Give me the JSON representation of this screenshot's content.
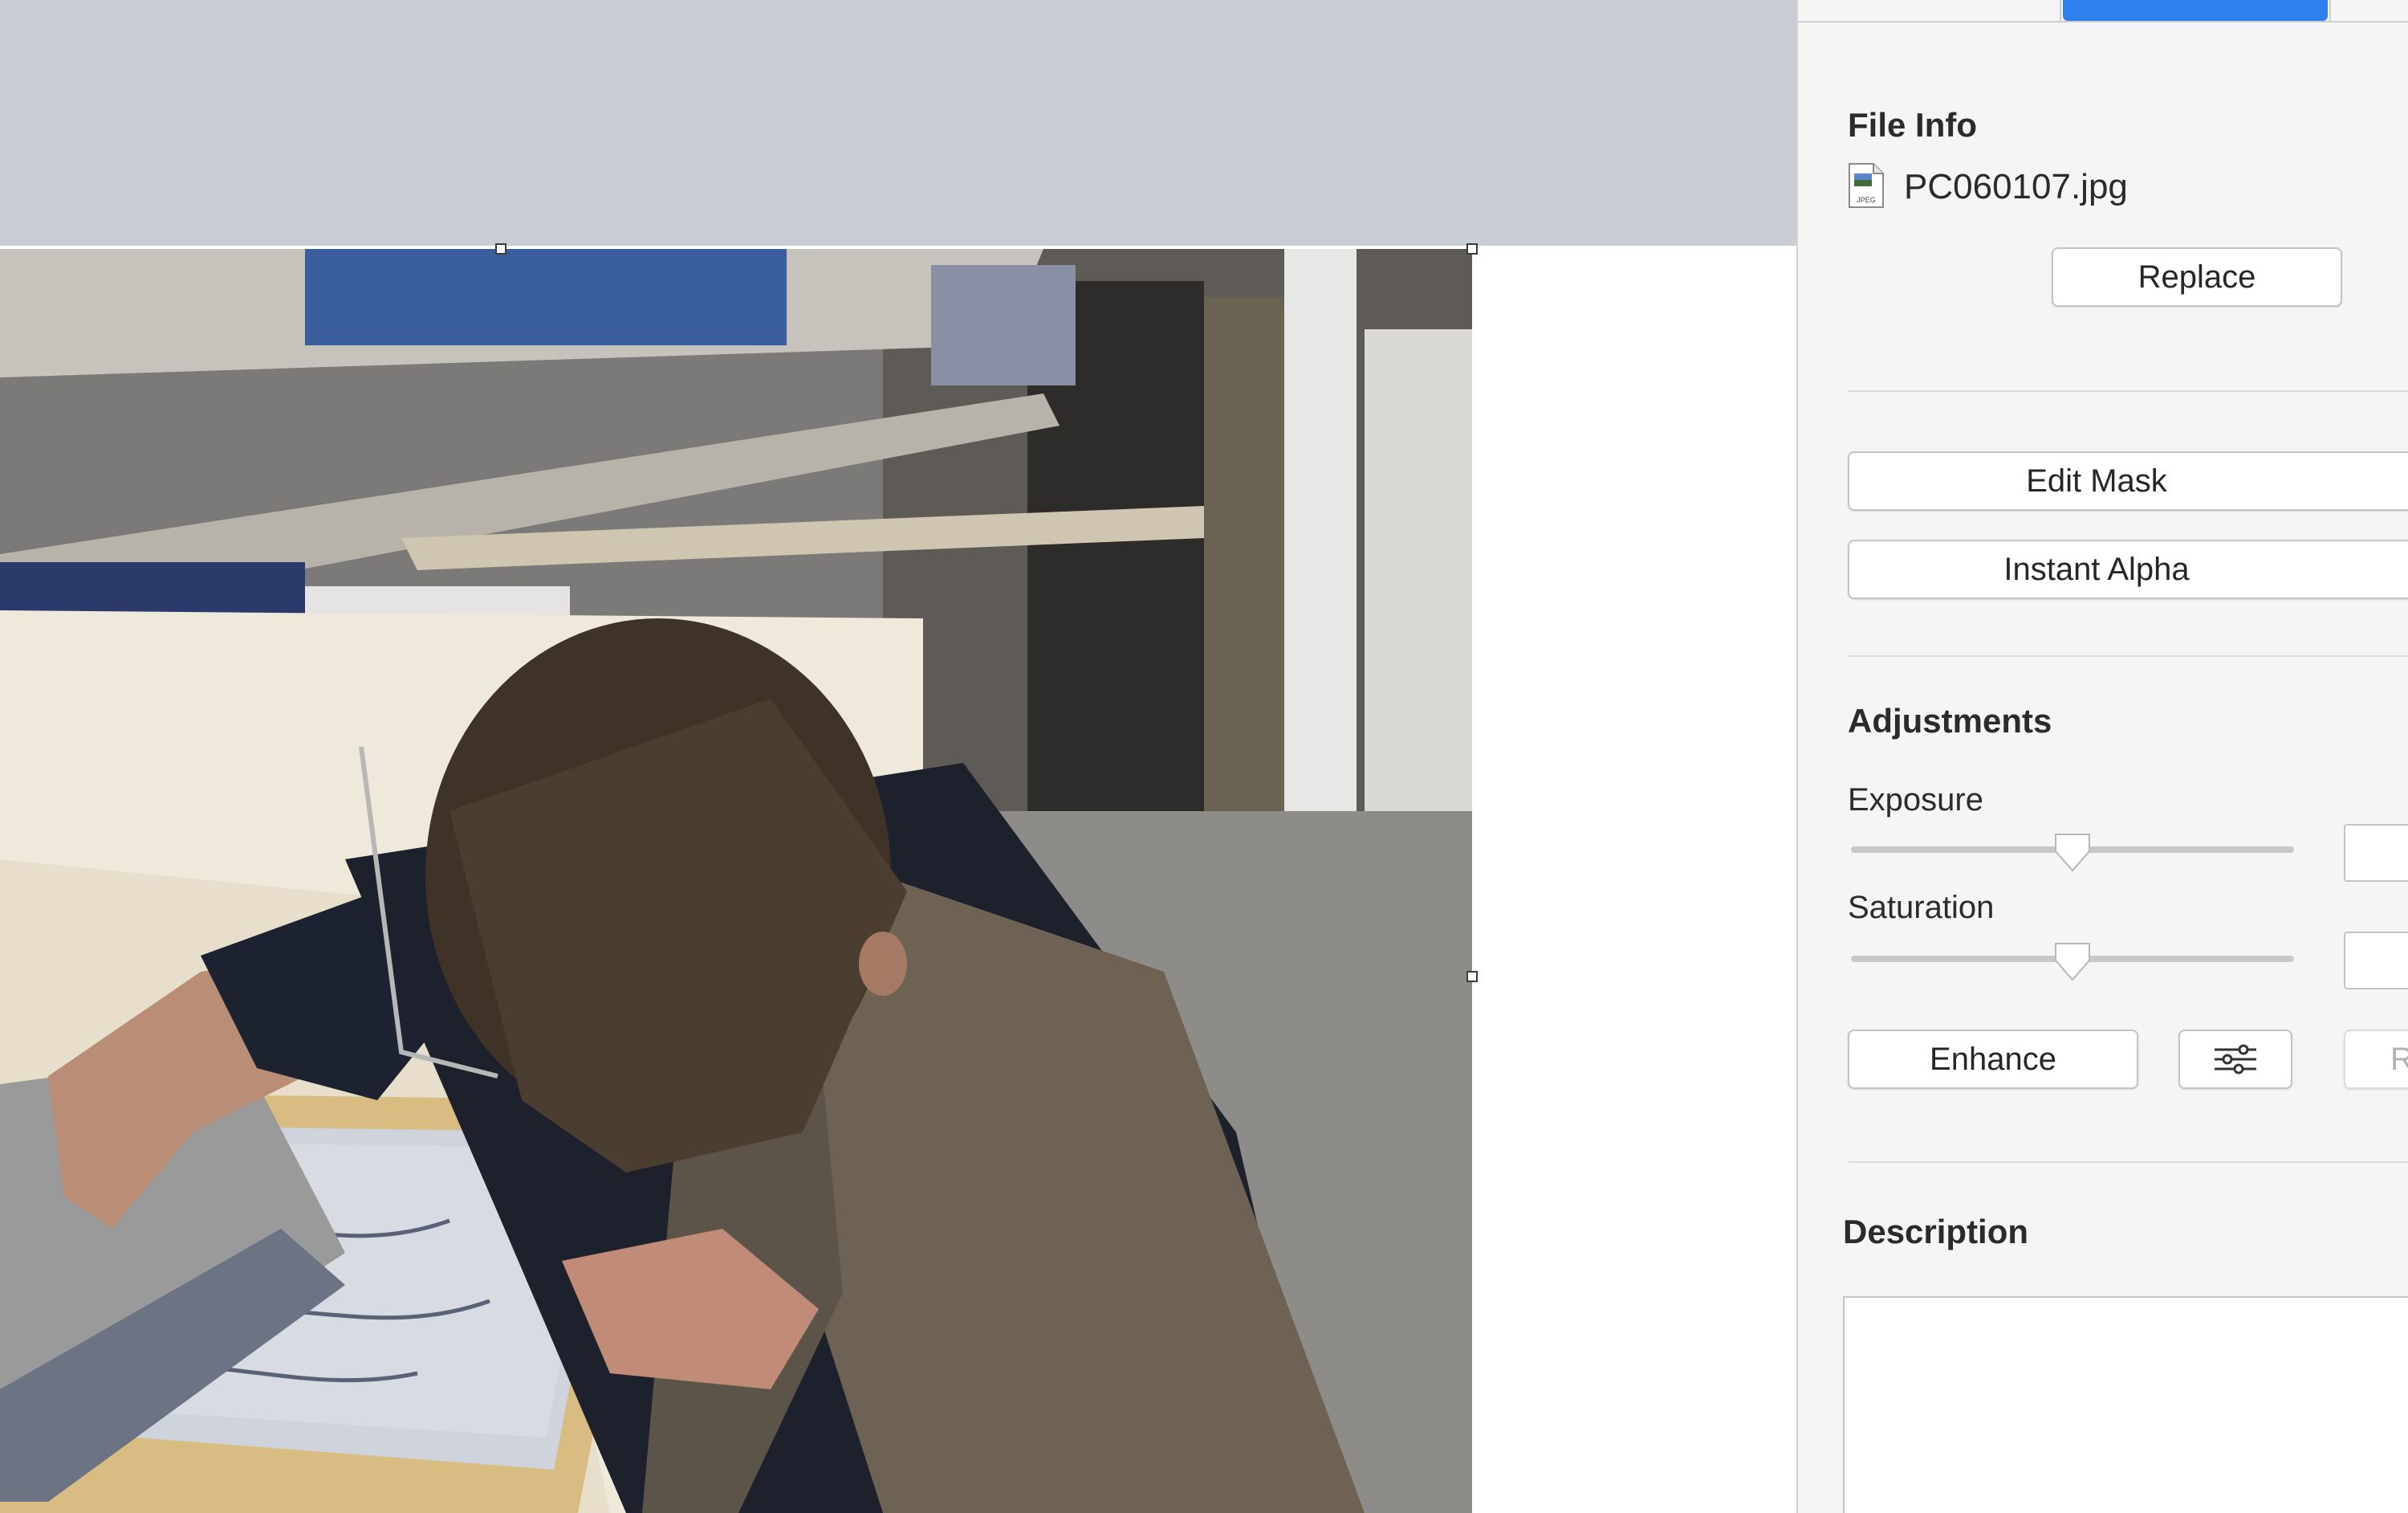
{
  "inspector": {
    "file_info": {
      "title": "File Info",
      "file_name": "PC060107.jpg",
      "file_icon_label": "JPEG",
      "replace_label": "Replace"
    },
    "edit_mask_label": "Edit Mask",
    "instant_alpha_label": "Instant Alpha",
    "adjustments": {
      "title": "Adjustments",
      "exposure": {
        "label": "Exposure",
        "value": 0.5
      },
      "saturation": {
        "label": "Saturation",
        "value": 0.5
      },
      "enhance_label": "Enhance",
      "reset_label": "R",
      "settings_icon": "sliders-icon"
    },
    "description": {
      "title": "Description"
    }
  },
  "colors": {
    "canvas_top": "#c9ced5",
    "panel_bg": "#f5f5f5",
    "accent_tab": "#2f80ed"
  }
}
